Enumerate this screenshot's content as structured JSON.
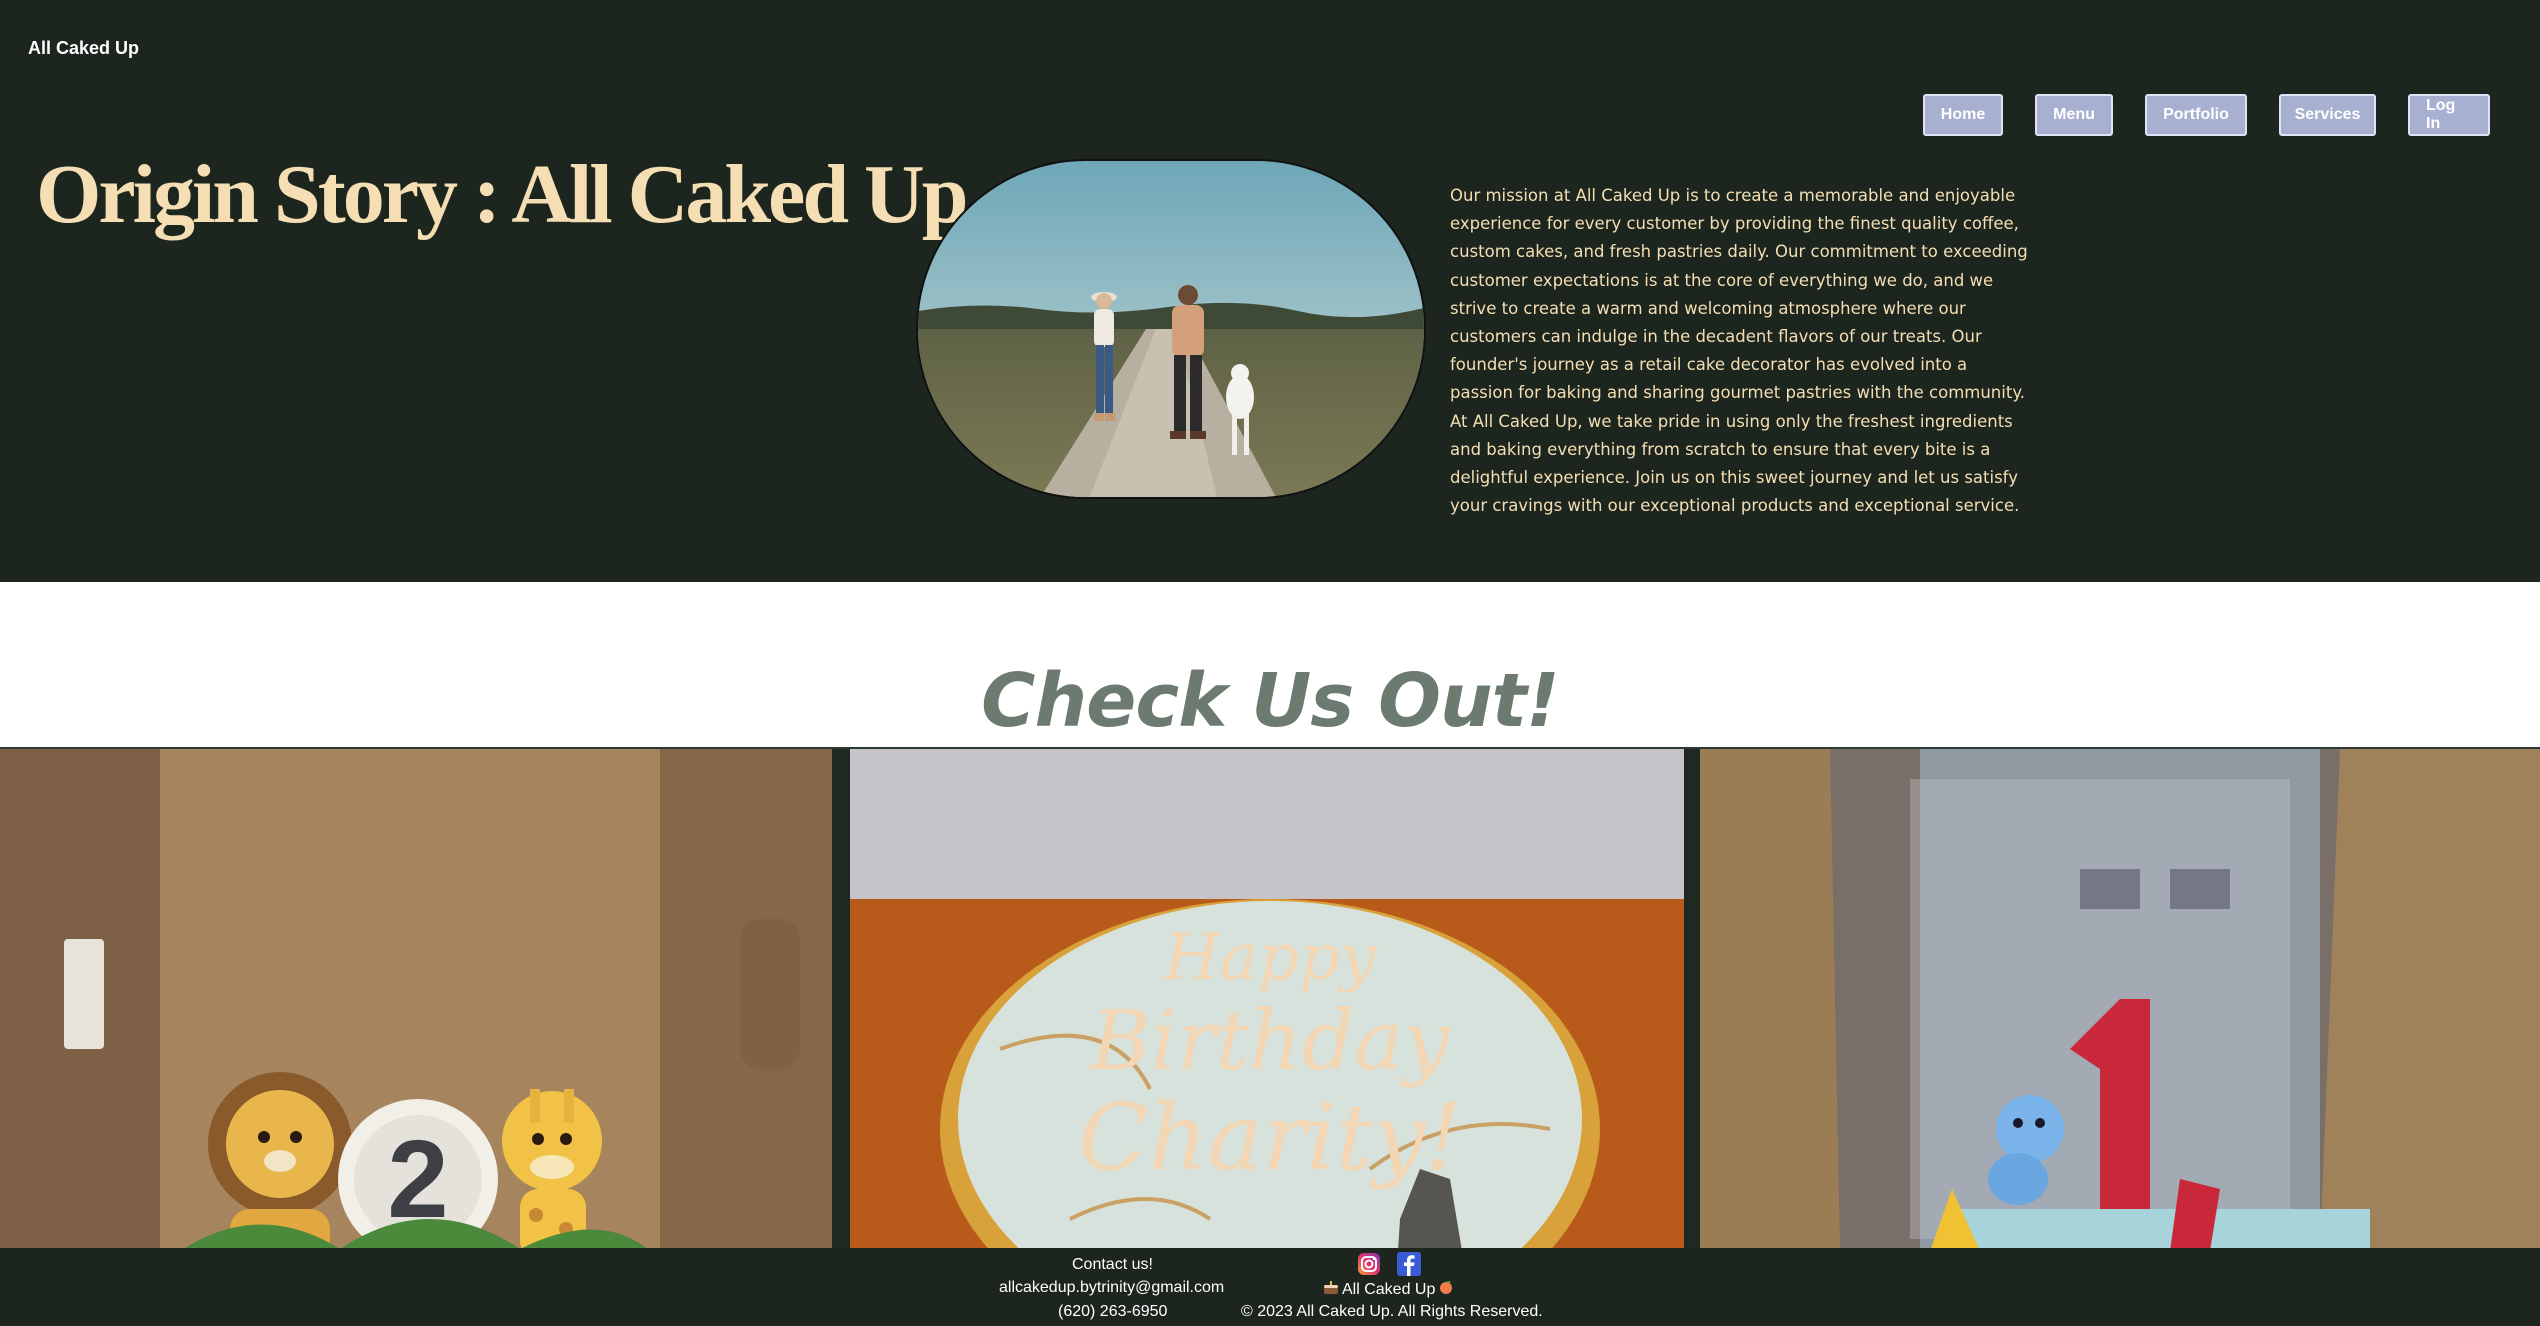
{
  "brand": "All Caked Up",
  "nav": {
    "home": "Home",
    "menu": "Menu",
    "portfolio": "Portfolio",
    "services": "Services",
    "login": "Log In"
  },
  "hero": {
    "title": "Origin Story : All Caked Up",
    "mission": "Our mission at All Caked Up is to create a memorable and enjoyable experience for every customer by providing the finest quality coffee, custom cakes, and fresh pastries daily. Our commitment to exceeding customer expectations is at the core of everything we do, and we strive to create a warm and welcoming atmosphere where our customers can indulge in the decadent flavors of our treats. Our founder's journey as a retail cake decorator has evolved into a passion for baking and sharing gourmet pastries with the community. At All Caked Up, we take pride in using only the freshest ingredients and baking everything from scratch to ensure that every bite is a delightful experience. Join us on this sweet journey and let us satisfy your cravings with our exceptional products and exceptional service."
  },
  "section": {
    "title": "Check Us Out!"
  },
  "gallery": {
    "cake2_text": "Happy Birthday Charity!"
  },
  "footer": {
    "contact_label": "Contact us!",
    "email": "allcakedup.bytrinity@gmail.com",
    "phone": "(620) 263-6950",
    "brand_line": "All Caked Up",
    "copyright": "© 2023 All Caked Up. All Rights Reserved."
  },
  "icons": [
    "instagram-icon",
    "facebook-icon",
    "cake-icon",
    "peach-icon"
  ],
  "colors": {
    "hero_bg": "#1c261f",
    "accent": "#f5deb3",
    "nav_btn": "#a8b0d2",
    "heading": "#6c7a6f"
  }
}
